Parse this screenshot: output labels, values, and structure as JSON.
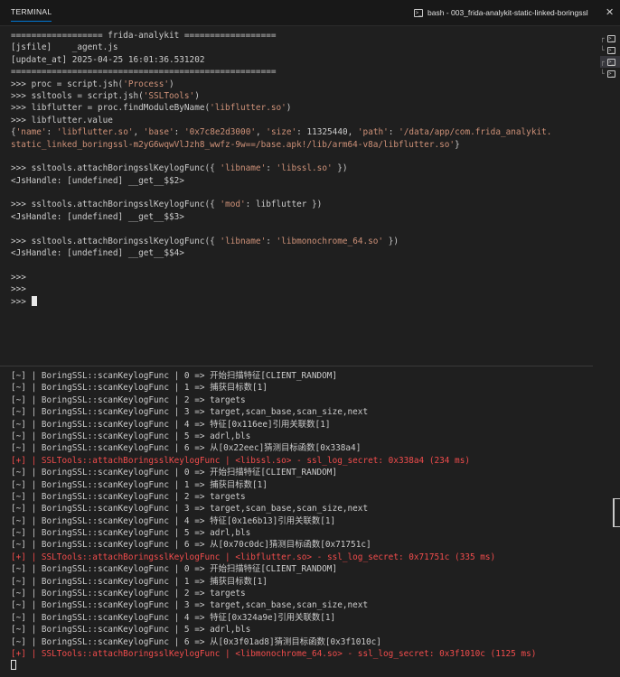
{
  "header": {
    "tab_label": "TERMINAL",
    "session_title": "bash - 003_frida-analykit-static-linked-boringssl",
    "close_glyph": "✕"
  },
  "colors": {
    "background": "#1f1f1f",
    "text": "#cccccc",
    "string": "#ce9178",
    "error": "#f14c4c",
    "accent": "#0078d4"
  },
  "terminal_top": {
    "lines": [
      {
        "segments": [
          {
            "t": "================== frida-analykit ==================",
            "c": ""
          }
        ]
      },
      {
        "segments": [
          {
            "t": "[jsfile]    _agent.js",
            "c": ""
          }
        ]
      },
      {
        "segments": [
          {
            "t": "[update_at] 2025-04-25 16:01:36.531202",
            "c": ""
          }
        ]
      },
      {
        "segments": [
          {
            "t": "====================================================",
            "c": ""
          }
        ]
      },
      {
        "segments": [
          {
            "t": ">>> proc = script.jsh(",
            "c": ""
          },
          {
            "t": "'Process'",
            "c": "str"
          },
          {
            "t": ")",
            "c": ""
          }
        ]
      },
      {
        "segments": [
          {
            "t": ">>> ssltools = script.jsh(",
            "c": ""
          },
          {
            "t": "'SSLTools'",
            "c": "str"
          },
          {
            "t": ")",
            "c": ""
          }
        ]
      },
      {
        "segments": [
          {
            "t": ">>> libflutter = proc.findModuleByName(",
            "c": ""
          },
          {
            "t": "'libflutter.so'",
            "c": "str"
          },
          {
            "t": ")",
            "c": ""
          }
        ]
      },
      {
        "segments": [
          {
            "t": ">>> libflutter.value",
            "c": ""
          }
        ]
      },
      {
        "segments": [
          {
            "t": "{",
            "c": ""
          },
          {
            "t": "'name'",
            "c": "str"
          },
          {
            "t": ": ",
            "c": ""
          },
          {
            "t": "'libflutter.so'",
            "c": "str"
          },
          {
            "t": ", ",
            "c": ""
          },
          {
            "t": "'base'",
            "c": "str"
          },
          {
            "t": ": ",
            "c": ""
          },
          {
            "t": "'0x7c8e2d3000'",
            "c": "str"
          },
          {
            "t": ", ",
            "c": ""
          },
          {
            "t": "'size'",
            "c": "str"
          },
          {
            "t": ": 11325440, ",
            "c": ""
          },
          {
            "t": "'path'",
            "c": "str"
          },
          {
            "t": ": ",
            "c": ""
          },
          {
            "t": "'/data/app/com.frida_analykit.",
            "c": "str"
          }
        ]
      },
      {
        "segments": [
          {
            "t": "static_linked_boringssl-m2yG6wqwVlJzh8_wwfz-9w==/base.apk!/lib/arm64-v8a/libflutter.so'",
            "c": "str"
          },
          {
            "t": "}",
            "c": ""
          }
        ]
      },
      {
        "segments": [
          {
            "t": "",
            "c": ""
          }
        ]
      },
      {
        "segments": [
          {
            "t": ">>> ssltools.attachBoringsslKeylogFunc({ ",
            "c": ""
          },
          {
            "t": "'libname'",
            "c": "str"
          },
          {
            "t": ": ",
            "c": ""
          },
          {
            "t": "'libssl.so'",
            "c": "str"
          },
          {
            "t": " })",
            "c": ""
          }
        ]
      },
      {
        "segments": [
          {
            "t": "<JsHandle: [undefined] __get__$$2>",
            "c": ""
          }
        ]
      },
      {
        "segments": [
          {
            "t": "",
            "c": ""
          }
        ]
      },
      {
        "segments": [
          {
            "t": ">>> ssltools.attachBoringsslKeylogFunc({ ",
            "c": ""
          },
          {
            "t": "'mod'",
            "c": "str"
          },
          {
            "t": ": libflutter })",
            "c": ""
          }
        ]
      },
      {
        "segments": [
          {
            "t": "<JsHandle: [undefined] __get__$$3>",
            "c": ""
          }
        ]
      },
      {
        "segments": [
          {
            "t": "",
            "c": ""
          }
        ]
      },
      {
        "segments": [
          {
            "t": ">>> ssltools.attachBoringsslKeylogFunc({ ",
            "c": ""
          },
          {
            "t": "'libname'",
            "c": "str"
          },
          {
            "t": ": ",
            "c": ""
          },
          {
            "t": "'libmonochrome_64.so'",
            "c": "str"
          },
          {
            "t": " })",
            "c": ""
          }
        ]
      },
      {
        "segments": [
          {
            "t": "<JsHandle: [undefined] __get__$$4>",
            "c": ""
          }
        ]
      },
      {
        "segments": [
          {
            "t": "",
            "c": ""
          }
        ]
      },
      {
        "segments": [
          {
            "t": ">>>",
            "c": ""
          }
        ]
      },
      {
        "segments": [
          {
            "t": ">>>",
            "c": ""
          }
        ]
      },
      {
        "segments": [
          {
            "t": ">>> ",
            "c": ""
          }
        ],
        "cursor": "block"
      }
    ]
  },
  "terminal_bottom": {
    "lines": [
      {
        "segments": [
          {
            "t": "[~] | BoringSSL::scanKeylogFunc | 0 => 开始扫描特征[CLIENT_RANDOM]",
            "c": ""
          }
        ]
      },
      {
        "segments": [
          {
            "t": "[~] | BoringSSL::scanKeylogFunc | 1 => 捕获目标数[1]",
            "c": ""
          }
        ]
      },
      {
        "segments": [
          {
            "t": "[~] | BoringSSL::scanKeylogFunc | 2 => targets",
            "c": ""
          }
        ]
      },
      {
        "segments": [
          {
            "t": "[~] | BoringSSL::scanKeylogFunc | 3 => target,scan_base,scan_size,next",
            "c": ""
          }
        ]
      },
      {
        "segments": [
          {
            "t": "[~] | BoringSSL::scanKeylogFunc | 4 => 特征[0x116ee]引用关联数[1]",
            "c": ""
          }
        ]
      },
      {
        "segments": [
          {
            "t": "[~] | BoringSSL::scanKeylogFunc | 5 => adrl,bls",
            "c": ""
          }
        ]
      },
      {
        "segments": [
          {
            "t": "[~] | BoringSSL::scanKeylogFunc | 6 => 从[0x22eec]猜测目标函数[0x338a4]",
            "c": ""
          }
        ]
      },
      {
        "segments": [
          {
            "t": "[+] | SSLTools::attachBoringsslKeylogFunc | <libssl.so> - ssl_log_secret: 0x338a4 (234 ms)",
            "c": "red"
          }
        ]
      },
      {
        "segments": [
          {
            "t": "[~] | BoringSSL::scanKeylogFunc | 0 => 开始扫描特征[CLIENT_RANDOM]",
            "c": ""
          }
        ]
      },
      {
        "segments": [
          {
            "t": "[~] | BoringSSL::scanKeylogFunc | 1 => 捕获目标数[1]",
            "c": ""
          }
        ]
      },
      {
        "segments": [
          {
            "t": "[~] | BoringSSL::scanKeylogFunc | 2 => targets",
            "c": ""
          }
        ]
      },
      {
        "segments": [
          {
            "t": "[~] | BoringSSL::scanKeylogFunc | 3 => target,scan_base,scan_size,next",
            "c": ""
          }
        ]
      },
      {
        "segments": [
          {
            "t": "[~] | BoringSSL::scanKeylogFunc | 4 => 特征[0x1e6b13]引用关联数[1]",
            "c": ""
          }
        ]
      },
      {
        "segments": [
          {
            "t": "[~] | BoringSSL::scanKeylogFunc | 5 => adrl,bls",
            "c": ""
          }
        ]
      },
      {
        "segments": [
          {
            "t": "[~] | BoringSSL::scanKeylogFunc | 6 => 从[0x70c0dc]猜测目标函数[0x71751c]",
            "c": ""
          }
        ]
      },
      {
        "segments": [
          {
            "t": "[+] | SSLTools::attachBoringsslKeylogFunc | <libflutter.so> - ssl_log_secret: 0x71751c (335 ms)",
            "c": "red"
          }
        ]
      },
      {
        "segments": [
          {
            "t": "[~] | BoringSSL::scanKeylogFunc | 0 => 开始扫描特征[CLIENT_RANDOM]",
            "c": ""
          }
        ]
      },
      {
        "segments": [
          {
            "t": "[~] | BoringSSL::scanKeylogFunc | 1 => 捕获目标数[1]",
            "c": ""
          }
        ]
      },
      {
        "segments": [
          {
            "t": "[~] | BoringSSL::scanKeylogFunc | 2 => targets",
            "c": ""
          }
        ]
      },
      {
        "segments": [
          {
            "t": "[~] | BoringSSL::scanKeylogFunc | 3 => target,scan_base,scan_size,next",
            "c": ""
          }
        ]
      },
      {
        "segments": [
          {
            "t": "[~] | BoringSSL::scanKeylogFunc | 4 => 特征[0x324a9e]引用关联数[1]",
            "c": ""
          }
        ]
      },
      {
        "segments": [
          {
            "t": "[~] | BoringSSL::scanKeylogFunc | 5 => adrl,bls",
            "c": ""
          }
        ]
      },
      {
        "segments": [
          {
            "t": "[~] | BoringSSL::scanKeylogFunc | 6 => 从[0x3f01ad8]猜测目标函数[0x3f1010c]",
            "c": ""
          }
        ]
      },
      {
        "segments": [
          {
            "t": "[+] | SSLTools::attachBoringsslKeylogFunc | <libmonochrome_64.so> - ssl_log_secret: 0x3f1010c (1125 ms)",
            "c": "red"
          }
        ]
      },
      {
        "segments": [
          {
            "t": "",
            "c": ""
          }
        ],
        "cursor": "outline"
      }
    ]
  },
  "side_terminals": [
    {
      "tree": "┌",
      "icon": "terminal-icon",
      "active": false
    },
    {
      "tree": "└",
      "icon": "terminal-icon",
      "active": false
    },
    {
      "tree": "┌",
      "icon": "terminal-icon",
      "active": true
    },
    {
      "tree": "└",
      "icon": "terminal-icon",
      "active": false
    }
  ]
}
